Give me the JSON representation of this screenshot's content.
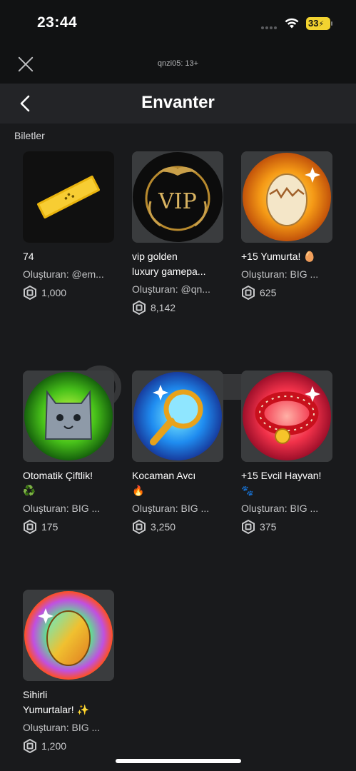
{
  "status": {
    "time": "23:44",
    "battery": "33"
  },
  "header": {
    "account": "qnzi05: 13+",
    "title": "Envanter"
  },
  "section": {
    "label": "Biletler"
  },
  "items": [
    {
      "name_line1": "74",
      "name_line2": "",
      "creator": "Oluşturan: @em...",
      "price": "1,000"
    },
    {
      "name_line1": "vip golden",
      "name_line2": "luxury gamepa...",
      "creator": "Oluşturan: @qn...",
      "price": "8,142"
    },
    {
      "name_line1": "+15 Yumurta! 🥚",
      "name_line2": "",
      "creator": "Oluşturan: BIG ...",
      "price": "625"
    },
    {
      "name_line1": "Otomatik Çiftlik!",
      "name_line2": "♻️",
      "creator": "Oluşturan: BIG ...",
      "price": "175"
    },
    {
      "name_line1": "Kocaman Avcı",
      "name_line2": "🔥",
      "creator": "Oluşturan: BIG ...",
      "price": "3,250"
    },
    {
      "name_line1": "+15 Evcil Hayvan!",
      "name_line2": "🐾",
      "creator": "Oluşturan: BIG ...",
      "price": "375"
    },
    {
      "name_line1": "Sihirli",
      "name_line2": "Yumurtalar! ✨",
      "creator": "Oluşturan: BIG ...",
      "price": "1,200"
    }
  ]
}
